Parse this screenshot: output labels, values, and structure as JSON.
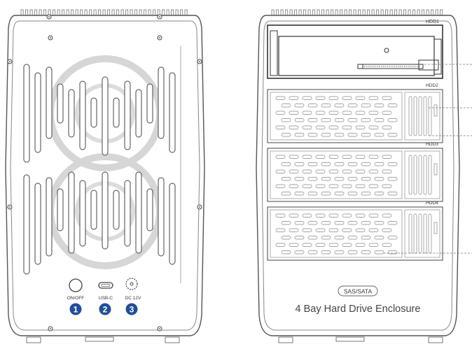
{
  "rear_panel": {
    "ports": [
      {
        "label": "ON/OFF",
        "number": "1"
      },
      {
        "label": "USB-C",
        "number": "2"
      },
      {
        "label": "DC 12V",
        "number": "3"
      }
    ],
    "badge_color": "#1f4e9c"
  },
  "front_panel": {
    "bays": [
      {
        "label": "HDD1"
      },
      {
        "label": "HDD2"
      },
      {
        "label": "HDD3"
      },
      {
        "label": "HDD4"
      }
    ],
    "interface_badge": "SAS/SATA",
    "product_title": "4 Bay Hard Drive Enclosure"
  },
  "colors": {
    "outline": "#555555",
    "light_outline": "#9a9a9a",
    "fan": "#cfcfcf"
  }
}
